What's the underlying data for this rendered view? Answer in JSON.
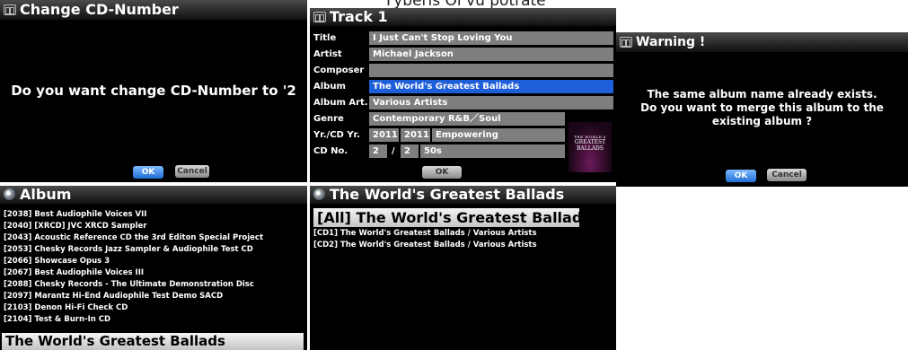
{
  "header_fragment": "Fyberis Oi vu potrate",
  "change_cd": {
    "title": "Change CD-Number",
    "question": "Do you want change CD-Number to '2",
    "ok": "OK",
    "cancel": "Cancel"
  },
  "track": {
    "title": "Track 1",
    "fields": {
      "title": {
        "label": "Title",
        "value": "I Just Can't Stop Loving You"
      },
      "artist": {
        "label": "Artist",
        "value": "Michael Jackson"
      },
      "composer": {
        "label": "Composer",
        "value": ""
      },
      "album": {
        "label": "Album",
        "value": "The World's Greatest Ballads"
      },
      "album_artist": {
        "label": "Album Art.",
        "value": "Various Artists"
      },
      "genre": {
        "label": "Genre",
        "value": "Contemporary R&B／Soul"
      },
      "yr_cd_yr": {
        "label": "Yr./CD Yr.",
        "v1": "2011",
        "v2": "2011",
        "v3": "Empowering"
      },
      "cd_no": {
        "label": "CD No.",
        "v1": "2",
        "v2": "/",
        "v3": "2",
        "v4": "50s"
      }
    },
    "cover": {
      "line1": "THE WORLD'S",
      "line2": "GREATEST",
      "line3": "BALLADS"
    },
    "ok": "OK"
  },
  "warning": {
    "title": "Warning !",
    "line1": "The same album name already exists.",
    "line2": "Do you want to merge this album to the",
    "line3": "existing album ?",
    "ok": "OK",
    "cancel": "Cancel"
  },
  "album_list": {
    "title": "Album",
    "items": [
      "[2038] Best Audiophile Voices VII",
      "[2040] [XRCD] JVC XRCD Sampler",
      "[2043] Acoustic Reference CD the 3rd Editon Special Project",
      "[2053] Chesky Records Jazz Sampler & Audiophile Test CD",
      "[2066] Showcase Opus 3",
      "[2067] Best Audiophile Voices III",
      "[2088] Chesky Records - The Ultimate Demonstration Disc",
      "[2097] Marantz Hi-End Audiophile Test Demo SACD",
      "[2103] Denon Hi-Fi Check CD",
      "[2104] Test & Burn-In CD"
    ],
    "selected": "The World's Greatest Ballads"
  },
  "ballads_list": {
    "title": "The World's Greatest Ballads",
    "selected": "[All] The World's Greatest Ballads",
    "items": [
      "[CD1] The World's Greatest Ballads / Various Artists",
      "[CD2] The World's Greatest Ballads / Various Artists"
    ]
  }
}
